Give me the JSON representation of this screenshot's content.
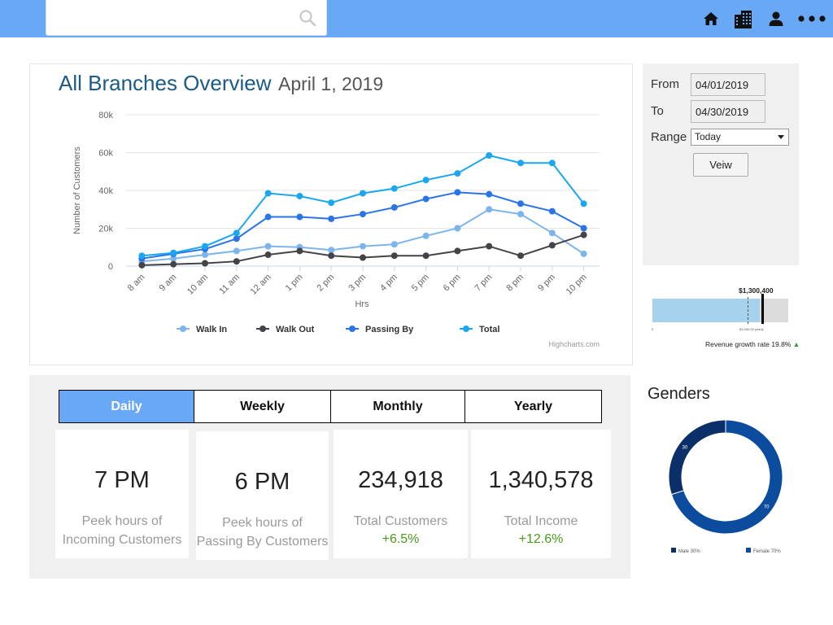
{
  "topbar": {
    "search_placeholder": "",
    "icons": [
      "search-icon",
      "home-icon",
      "buildings-icon",
      "user-icon",
      "more-icon"
    ]
  },
  "header": {
    "title": "All Branches Overview",
    "date": "April 1, 2019"
  },
  "date_panel": {
    "from_label": "From",
    "from_value": "04/01/2019",
    "to_label": "To",
    "to_value": "04/30/2019",
    "range_label": "Range",
    "range_value": "Today",
    "view_button": "Veiw"
  },
  "revenue": {
    "amount": "$1,300,400",
    "growth_text": "Revenue growth rate 19.8%",
    "growth_arrow": "▲",
    "tick_start": "0",
    "tick_target": "$1,000,00 yearly",
    "fill_fraction": 0.79,
    "target_fraction": 0.7,
    "marker_fraction": 0.8
  },
  "tabs": [
    {
      "label": "Daily",
      "active": true
    },
    {
      "label": "Weekly",
      "active": false
    },
    {
      "label": "Monthly",
      "active": false
    },
    {
      "label": "Yearly",
      "active": false
    }
  ],
  "stats": [
    {
      "value": "7 PM",
      "label_line1": "Peek hours of",
      "label_line2": "Incoming Customers",
      "delta": ""
    },
    {
      "value": "6 PM",
      "label_line1": "Peek hours of",
      "label_line2": "Passing By Customers",
      "delta": ""
    },
    {
      "value": "234,918",
      "label_line1": "Total Customers",
      "label_line2": "",
      "delta": "+6.5%"
    },
    {
      "value": "1,340,578",
      "label_line1": "Total Income",
      "label_line2": "",
      "delta": "+12.6%"
    }
  ],
  "genders": {
    "title": "Genders"
  },
  "colors": {
    "topbar": "#68a8f5",
    "title": "#1c5a87",
    "walk_in": "#7cb5ec",
    "walk_out": "#434348",
    "passing_by": "#2b74e8",
    "total": "#1aa7ef",
    "male": "#0b2f68",
    "female": "#0b4c9e",
    "positive": "#4c9a1c"
  },
  "chart_data": [
    {
      "type": "line",
      "title": "",
      "xlabel": "Hrs",
      "ylabel": "Number of Customers",
      "credits": "Highcharts.com",
      "categories": [
        "8 am",
        "9 am",
        "10 am",
        "11 am",
        "12 am",
        "1 pm",
        "2 pm",
        "3 pm",
        "4 pm",
        "5 pm",
        "6 pm",
        "7 pm",
        "8 pm",
        "9 pm",
        "10 pm"
      ],
      "ylim": [
        0,
        80000
      ],
      "yticks": [
        0,
        20000,
        40000,
        60000,
        80000
      ],
      "ytick_labels": [
        "0",
        "20k",
        "40k",
        "60k",
        "80k"
      ],
      "grid": true,
      "legend": "bottom",
      "series": [
        {
          "name": "Walk In",
          "color": "#7cb5ec",
          "values": [
            2500,
            4000,
            6000,
            8000,
            10500,
            10000,
            8500,
            10500,
            11500,
            16000,
            20000,
            30000,
            27500,
            17500,
            6500
          ]
        },
        {
          "name": "Walk Out",
          "color": "#434348",
          "values": [
            500,
            1000,
            1500,
            2500,
            6000,
            8000,
            5500,
            4500,
            5500,
            5500,
            8000,
            10500,
            5500,
            11000,
            16500
          ]
        },
        {
          "name": "Passing By",
          "color": "#2b74e8",
          "values": [
            4000,
            6500,
            9000,
            14500,
            26000,
            26000,
            25000,
            27500,
            31000,
            35500,
            39000,
            38000,
            33000,
            29000,
            20000
          ]
        },
        {
          "name": "Total",
          "color": "#1aa7ef",
          "values": [
            5500,
            7000,
            10500,
            17500,
            38500,
            37000,
            33500,
            38500,
            41000,
            45500,
            49000,
            58500,
            54500,
            54500,
            33000
          ]
        }
      ]
    },
    {
      "type": "pie",
      "title": "Genders",
      "categories": [
        "Male 30%",
        "Female 70%"
      ],
      "values": [
        30,
        70
      ],
      "data_labels": [
        "30",
        "70"
      ],
      "colors": [
        "#0b2f68",
        "#0b4c9e"
      ],
      "legend": "bottom"
    }
  ]
}
